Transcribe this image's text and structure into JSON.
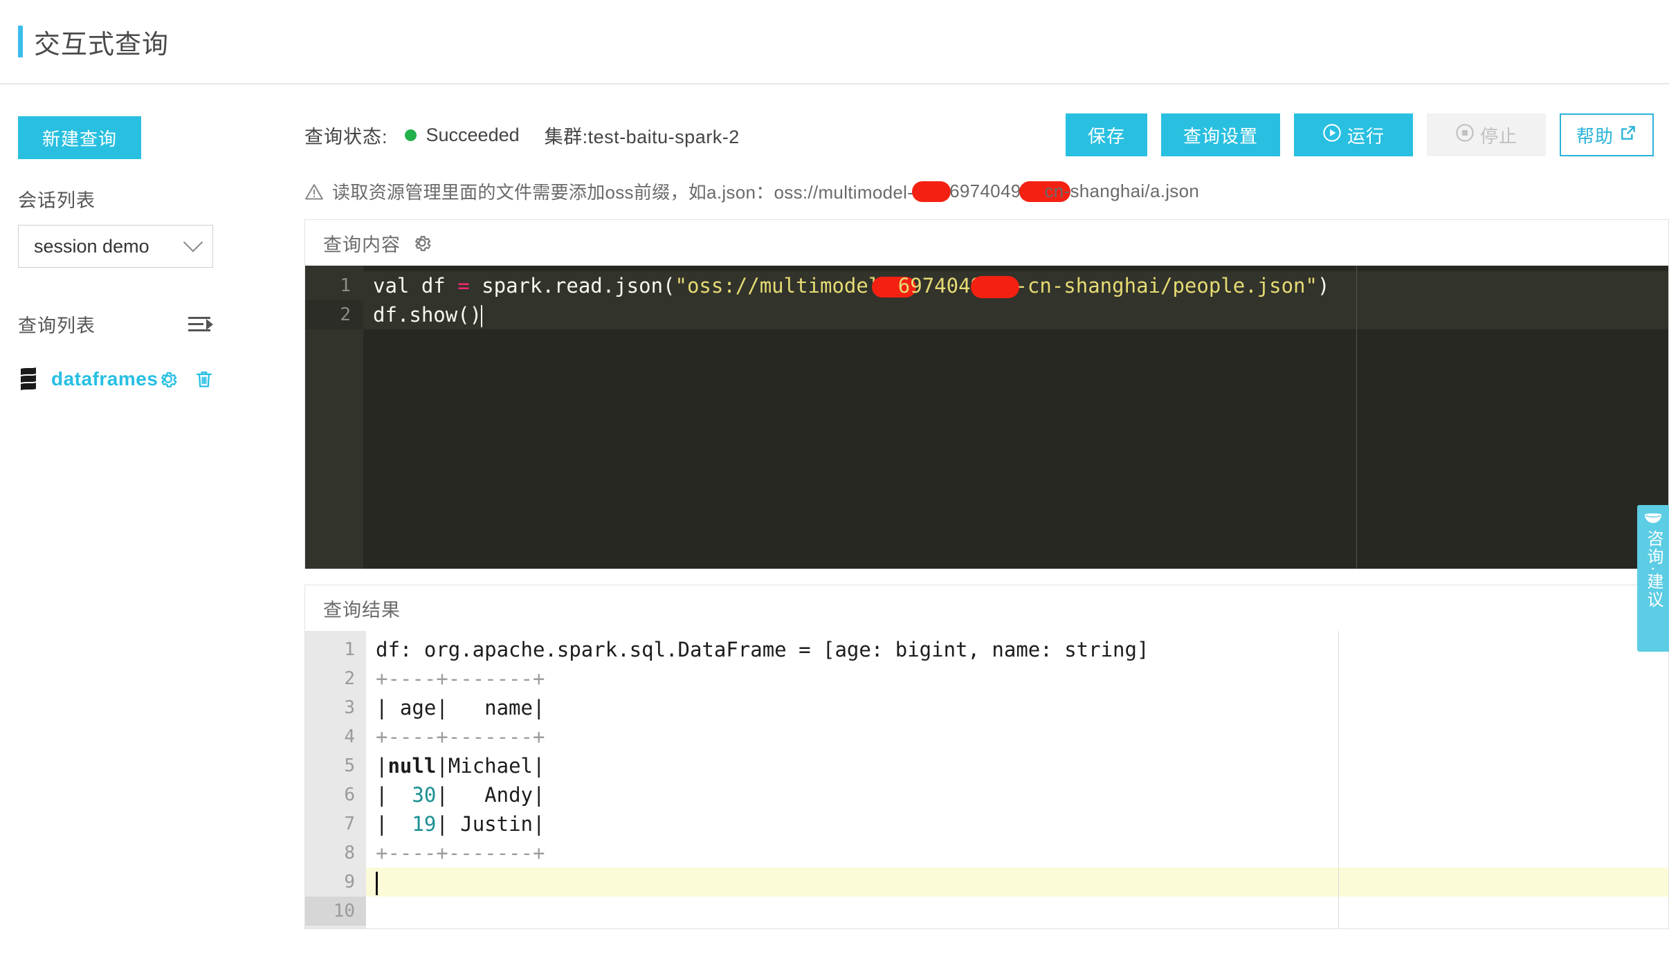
{
  "header": {
    "title": "交互式查询"
  },
  "sidebar": {
    "new_query_label": "新建查询",
    "session_list_label": "会话列表",
    "session_selected": "session demo",
    "query_list_label": "查询列表",
    "query_items": [
      {
        "label": "dataframes",
        "icon": "scala-icon"
      }
    ]
  },
  "toolbar": {
    "status_label": "查询状态:",
    "status_value": "Succeeded",
    "status_color": "#22b14c",
    "cluster_text": "集群:test-baitu-spark-2",
    "save_label": "保存",
    "settings_label": "查询设置",
    "run_label": "运行",
    "stop_label": "停止",
    "help_label": "帮助"
  },
  "notice": {
    "prefix": "读取资源管理里面的文件需要添加oss前缀，如a.json：oss://multimodel-",
    "mid": "6974049",
    "suffix": "cn-shanghai/a.json"
  },
  "editor": {
    "panel_title": "查询内容",
    "accent": "#29bfe0",
    "line_numbers": [
      "1",
      "2"
    ],
    "code": {
      "l1_a": "val df ",
      "l1_eq": "=",
      "l1_b": " spark.read.json(",
      "l1_str_open": "\"oss://multimodel-",
      "l1_str_mid": "69740496",
      "l1_str_end": "-cn-shanghai/people.json\"",
      "l1_close": ")",
      "l2": "df.show()"
    }
  },
  "results": {
    "panel_title": "查询结果",
    "line_numbers": [
      "1",
      "2",
      "3",
      "4",
      "5",
      "6",
      "7",
      "8",
      "9",
      "10"
    ],
    "lines": [
      {
        "n": "1",
        "text": "df: org.apache.spark.sql.DataFrame = [age: bigint, name: string]"
      },
      {
        "n": "2",
        "text": "+----+-------+"
      },
      {
        "n": "3",
        "text": "| age|   name|"
      },
      {
        "n": "4",
        "text": "+----+-------+"
      },
      {
        "n": "5",
        "text": "|null|Michael|"
      },
      {
        "n": "6",
        "text": "|  30|   Andy|"
      },
      {
        "n": "7",
        "text": "|  19| Justin|"
      },
      {
        "n": "8",
        "text": "+----+-------+"
      },
      {
        "n": "9",
        "text": ""
      },
      {
        "n": "10",
        "text": ""
      }
    ],
    "table": {
      "columns": [
        "age",
        "name"
      ],
      "rows": [
        [
          "null",
          "Michael"
        ],
        [
          "30",
          "Andy"
        ],
        [
          "19",
          "Justin"
        ]
      ]
    },
    "schema": "df: org.apache.spark.sql.DataFrame = [age: bigint, name: string]"
  },
  "feedback": {
    "text": "咨询·建议"
  }
}
